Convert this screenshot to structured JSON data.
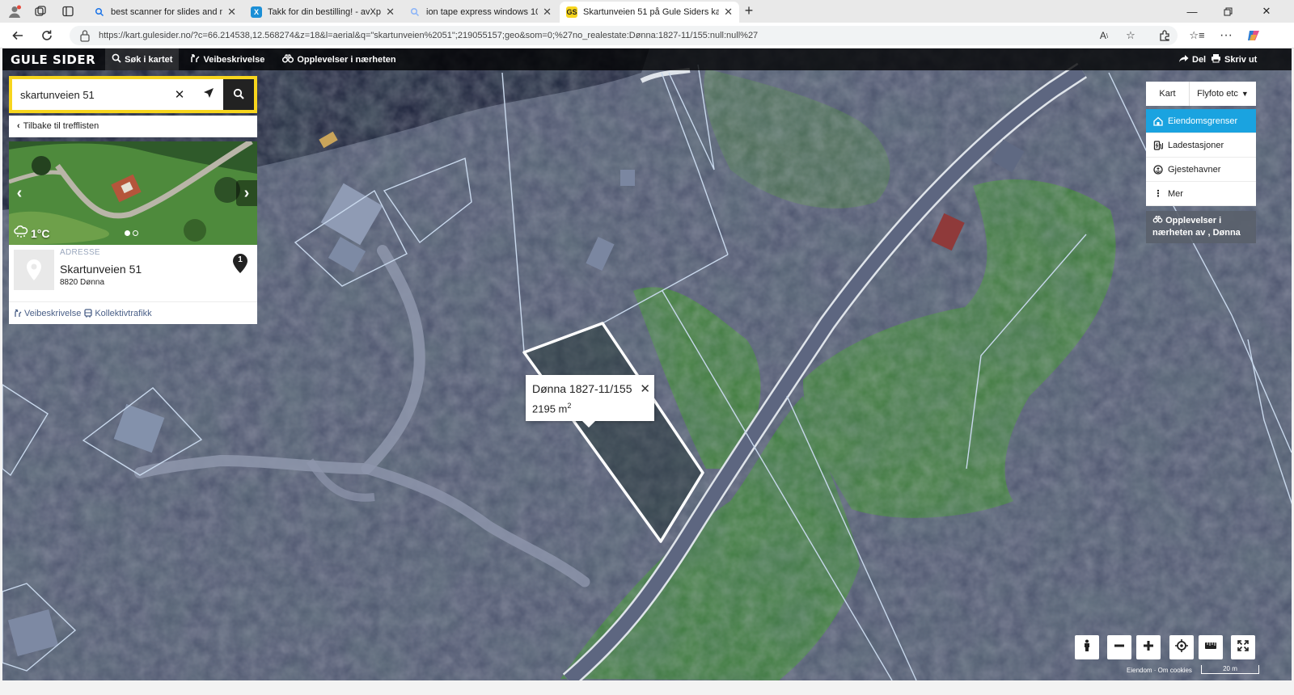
{
  "browser": {
    "tabs": [
      {
        "title": "best scanner for slides and negati",
        "favicon": "search-icon",
        "active": false
      },
      {
        "title": "Takk for din bestilling! - avXperten",
        "favicon": "x-icon",
        "active": false
      },
      {
        "title": "ion tape express windows 10 - Sø",
        "favicon": "search-icon",
        "active": false
      },
      {
        "title": "Skartunveien 51 på Gule Siders kart",
        "favicon": "gs-icon",
        "active": true
      }
    ],
    "url": "https://kart.gulesider.no/?c=66.214538,12.568274&z=18&l=aerial&q=\"skartunveien%2051\";219055157;geo&som=0;%27no_realestate:Dønna:1827-11/155:null:null%27"
  },
  "app": {
    "logo": "GULE SIDER",
    "nav": [
      {
        "label": "Søk i kartet",
        "icon": "search-icon"
      },
      {
        "label": "Veibeskrivelse",
        "icon": "directions-icon"
      },
      {
        "label": "Opplevelser i nærheten",
        "icon": "binoculars-icon"
      }
    ],
    "share_label": "Del",
    "print_label": "Skriv ut"
  },
  "search": {
    "value": "skartunveien 51",
    "back_label": "Tilbake til trefflisten"
  },
  "result": {
    "weather": "1°C",
    "label": "ADRESSE",
    "name": "Skartunveien 51",
    "city": "8820 Dønna",
    "marker_number": "1",
    "links": [
      "Veibeskrivelse",
      "Kollektivtrafikk"
    ]
  },
  "layers": {
    "tab_map": "Kart",
    "tab_photo": "Flyfoto etc",
    "items": [
      {
        "label": "Eiendomsgrenser",
        "icon": "property-icon",
        "active": true
      },
      {
        "label": "Ladestasjoner",
        "icon": "charging-icon",
        "active": false
      },
      {
        "label": "Gjestehavner",
        "icon": "harbor-icon",
        "active": false
      },
      {
        "label": "Mer",
        "icon": "more-icon",
        "active": false
      }
    ],
    "experiences": "Opplevelser i nærheten av , Dønna"
  },
  "popup": {
    "title": "Dønna 1827-11/155",
    "area": "2195 m",
    "area_unit_sup": "2"
  },
  "footer": {
    "attribution": "Eiendom · Om cookies",
    "scale": "20 m"
  }
}
